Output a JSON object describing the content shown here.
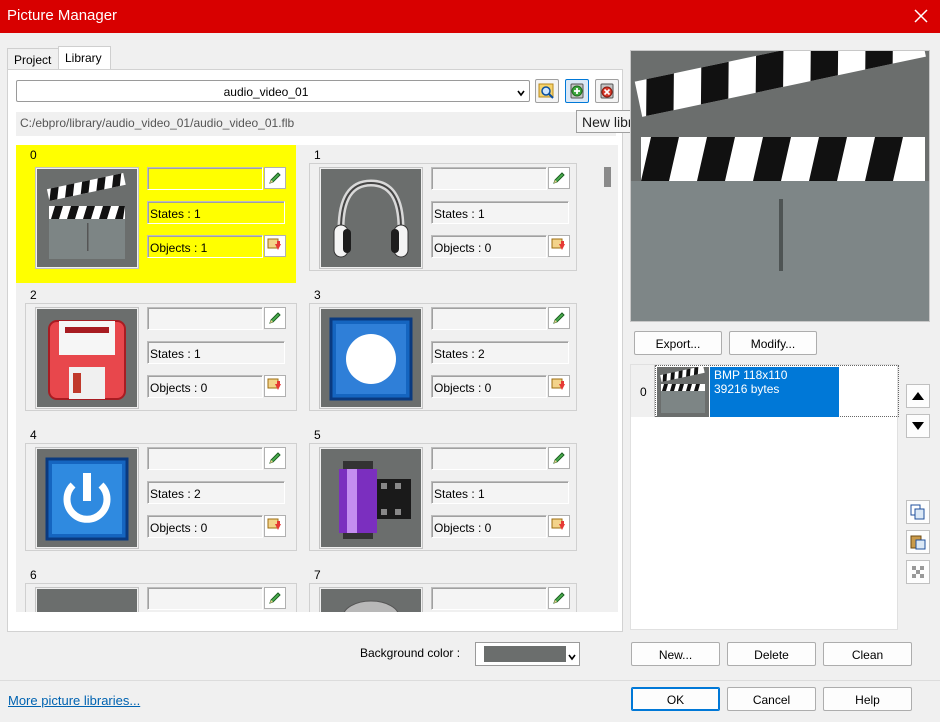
{
  "window": {
    "title": "Picture Manager"
  },
  "tabs": [
    {
      "label": "Project"
    },
    {
      "label": "Library"
    }
  ],
  "library": {
    "selected": "audio_video_01",
    "path": "C:/ebpro/library/audio_video_01/audio_video_01.flb",
    "tooltip": "New library"
  },
  "pictures": [
    {
      "index": "0",
      "name": "",
      "states": "States : 1",
      "objects": "Objects : 1",
      "icon": "clapperboard-icon"
    },
    {
      "index": "1",
      "name": "",
      "states": "States : 1",
      "objects": "Objects : 0",
      "icon": "headphones-icon"
    },
    {
      "index": "2",
      "name": "",
      "states": "States : 1",
      "objects": "Objects : 0",
      "icon": "floppy-disk-icon"
    },
    {
      "index": "3",
      "name": "",
      "states": "States : 2",
      "objects": "Objects : 0",
      "icon": "record-button-icon"
    },
    {
      "index": "4",
      "name": "",
      "states": "States : 2",
      "objects": "Objects : 0",
      "icon": "power-button-icon"
    },
    {
      "index": "5",
      "name": "",
      "states": "States : 1",
      "objects": "Objects : 0",
      "icon": "film-roll-icon"
    },
    {
      "index": "6",
      "name": "",
      "icon": "blank-icon"
    },
    {
      "index": "7",
      "name": "",
      "icon": "partial-icon"
    }
  ],
  "preview": {
    "export_label": "Export...",
    "modify_label": "Modify..."
  },
  "state_list": {
    "rows": [
      {
        "index": "0",
        "format": "BMP 118x110",
        "size": "39216 bytes"
      }
    ],
    "new_label": "New...",
    "delete_label": "Delete",
    "clean_label": "Clean"
  },
  "background": {
    "label": "Background color :",
    "color": "#6b6e6d"
  },
  "footer": {
    "more_link": "More picture libraries...",
    "ok_label": "OK",
    "cancel_label": "Cancel",
    "help_label": "Help"
  }
}
